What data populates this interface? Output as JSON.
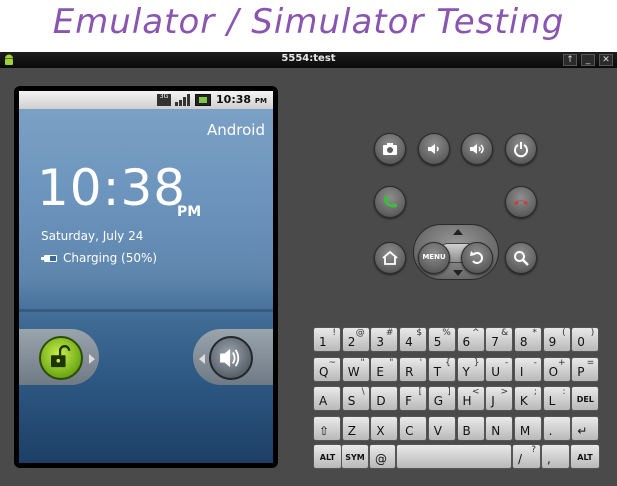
{
  "banner": {
    "title": "Emulator / Simulator Testing"
  },
  "window": {
    "title": "5554:test",
    "buttons": [
      "↑",
      "_",
      "✕"
    ]
  },
  "phone": {
    "status_bar": {
      "network": "3G",
      "time": "10:38",
      "ampm": "PM"
    },
    "carrier": "Android",
    "clock": "10:38",
    "clock_ampm": "PM",
    "date": "Saturday, July 24",
    "charging": "Charging (50%)"
  },
  "controls": {
    "menu_label": "MENU",
    "icons": [
      "camera-icon",
      "volume-down-icon",
      "volume-up-icon",
      "power-icon",
      "call-icon",
      "end-call-icon",
      "home-icon",
      "menu-icon",
      "back-icon",
      "search-icon"
    ]
  },
  "keyboard": {
    "row1": [
      {
        "main": "1",
        "alt": "!"
      },
      {
        "main": "2",
        "alt": "@"
      },
      {
        "main": "3",
        "alt": "#"
      },
      {
        "main": "4",
        "alt": "$"
      },
      {
        "main": "5",
        "alt": "%"
      },
      {
        "main": "6",
        "alt": "^"
      },
      {
        "main": "7",
        "alt": "&"
      },
      {
        "main": "8",
        "alt": "*"
      },
      {
        "main": "9",
        "alt": "("
      },
      {
        "main": "0",
        "alt": ")"
      }
    ],
    "row2": [
      {
        "main": "Q",
        "alt": "~"
      },
      {
        "main": "W",
        "alt": "\""
      },
      {
        "main": "E",
        "alt": "\""
      },
      {
        "main": "R",
        "alt": "'"
      },
      {
        "main": "T",
        "alt": "{"
      },
      {
        "main": "Y",
        "alt": "}"
      },
      {
        "main": "U",
        "alt": "-"
      },
      {
        "main": "I",
        "alt": "-"
      },
      {
        "main": "O",
        "alt": "+"
      },
      {
        "main": "P",
        "alt": "="
      }
    ],
    "row3": [
      {
        "main": "A",
        "alt": ""
      },
      {
        "main": "S",
        "alt": "\\"
      },
      {
        "main": "D",
        "alt": ""
      },
      {
        "main": "F",
        "alt": "["
      },
      {
        "main": "G",
        "alt": "]"
      },
      {
        "main": "H",
        "alt": "<"
      },
      {
        "main": "J",
        "alt": ">"
      },
      {
        "main": "K",
        "alt": ";"
      },
      {
        "main": "L",
        "alt": ":"
      },
      {
        "main": "DEL",
        "alt": ""
      }
    ],
    "row4": [
      {
        "main": "⇧",
        "alt": ""
      },
      {
        "main": "Z",
        "alt": ""
      },
      {
        "main": "X",
        "alt": ""
      },
      {
        "main": "C",
        "alt": ""
      },
      {
        "main": "V",
        "alt": ""
      },
      {
        "main": "B",
        "alt": ""
      },
      {
        "main": "N",
        "alt": ""
      },
      {
        "main": "M",
        "alt": ""
      },
      {
        "main": ".",
        "alt": ""
      },
      {
        "main": "↵",
        "alt": ""
      }
    ],
    "row5": [
      {
        "main": "ALT",
        "alt": ""
      },
      {
        "main": "SYM",
        "alt": ""
      },
      {
        "main": "@",
        "alt": ""
      },
      {
        "main": "",
        "alt": ""
      },
      {
        "main": "/",
        "alt": "?"
      },
      {
        "main": ",",
        "alt": ""
      },
      {
        "main": "ALT",
        "alt": ""
      }
    ]
  }
}
